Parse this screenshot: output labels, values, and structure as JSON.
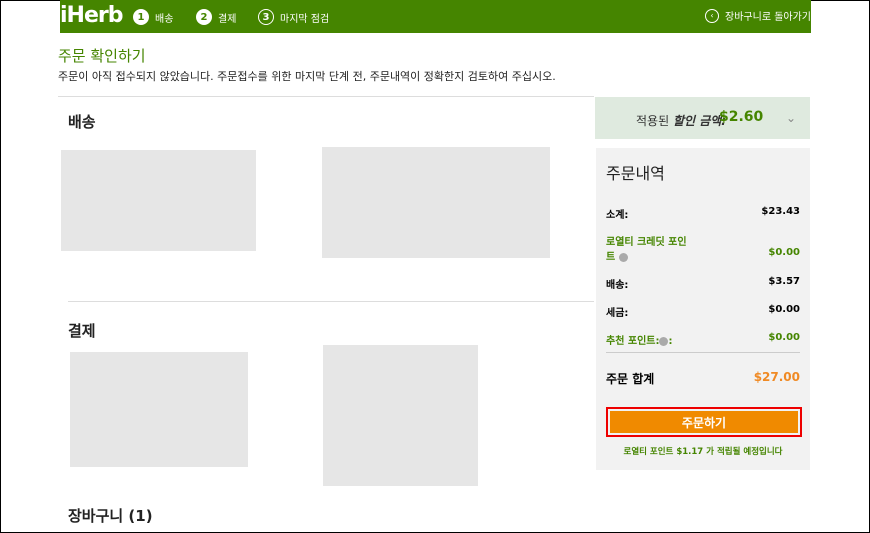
{
  "header": {
    "logo": "iHerb",
    "steps": [
      {
        "num": "1",
        "label": "배송"
      },
      {
        "num": "2",
        "label": "결제"
      },
      {
        "num": "3",
        "label": "마지막 점검"
      }
    ],
    "back_label": "장바구니로 돌아가기",
    "back_icon": "‹",
    "brand_color": "#458500"
  },
  "page": {
    "title": "주문 확인하기",
    "subtitle": "주문이 아직 접수되지 않았습니다. 주문접수를 위한 마지막 단계 전, 주문내역이 정확한지 검토하여 주십시오."
  },
  "sections": {
    "shipping": "배송",
    "payment": "결제",
    "cart": "장바구니 (1)"
  },
  "discount": {
    "label_prefix": "적용된 ",
    "label_emphasis": "할인 금액:",
    "amount": "$2.60",
    "chevron": "⌄"
  },
  "summary": {
    "title": "주문내역",
    "rows": [
      {
        "label": "소계:",
        "value": "$23.43"
      },
      {
        "label_line1": "로열티 크레딧 포인",
        "label_line2": "트",
        "value": "$0.00"
      },
      {
        "label": "배송:",
        "value": "$3.57"
      },
      {
        "label": "세금:",
        "value": "$0.00"
      },
      {
        "label": "추천 포인트:",
        "label_suffix": ":",
        "value": "$0.00"
      }
    ],
    "total_label": "주문 합계",
    "total_value": "$27.00",
    "order_button": "주문하기",
    "loyalty_note": "로열티 포인트 $1.17 가 적립될 예정입니다",
    "accent_color": "#f08a00",
    "highlight_color": "#e00000"
  }
}
